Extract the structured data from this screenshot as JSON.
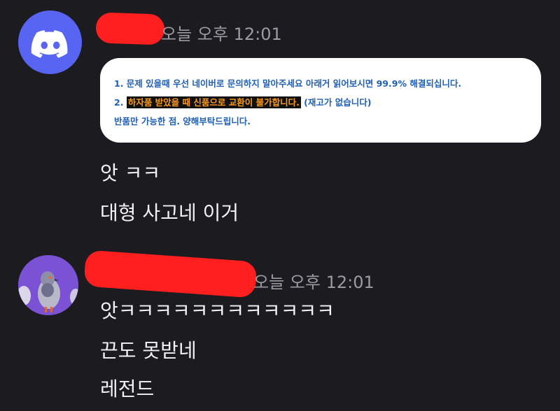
{
  "messages": [
    {
      "avatar": "discord-logo-icon",
      "timestamp": "오늘 오후 12:01",
      "notice": {
        "line1": "1. 문제 있을때 우선 네이버로 문의하지 말아주세요 아래거 읽어보시면 99.9% 해결되십니다.",
        "line2_prefix": "2. ",
        "line2_highlight": "하자품 받았을 때 신품으로 교환이 불가합니다.",
        "line2_suffix": " (재고가 없습니다)",
        "line3": "반품만 가능한 점. 양해부탁드립니다."
      },
      "lines": [
        "앗 ㅋㅋ",
        "대형 사고네 이거"
      ]
    },
    {
      "avatar": "pigeon-avatar-icon",
      "timestamp": "오늘 오후 12:01",
      "lines": [
        "앗ㅋㅋㅋㅋㅋㅋㅋㅋㅋㅋㅋㅋ",
        "끈도 못받네",
        "레전드"
      ]
    }
  ],
  "colors": {
    "background": "#1b1b20",
    "discord_blurple": "#5865f2",
    "redaction": "#ff1f1f",
    "highlight_text": "#ff9a1a"
  }
}
